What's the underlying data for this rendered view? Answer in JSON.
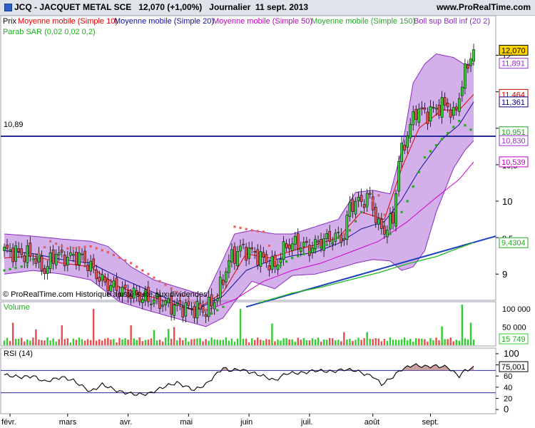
{
  "header": {
    "title": "JCQ - JACQUET METAL SCE   12,070 (+1,00%)   Journalier  11 sept. 2013",
    "site": "www.ProRealTime.com"
  },
  "legend": {
    "prix": "Prix",
    "ma10": "Moyenne mobile (Simple 10)",
    "ma20": "Moyenne mobile (Simple 20)",
    "ma50": "Moyenne mobile (Simple 50)",
    "ma150": "Moyenne mobile (Simple 150)",
    "boll": "Boll sup Boll inf (20 2)",
    "sar": "Parab SAR (0,02 0,02 0,2)"
  },
  "copyright": "© ProRealTime.com  Historique ajusté suite aux dividendes",
  "hline_label": "10,89",
  "price_tags": [
    {
      "text": "12,070",
      "value": 12.07,
      "bg": "#ffd400",
      "fg": "#000000",
      "border": "#000000"
    },
    {
      "text": "11,891",
      "value": 11.891,
      "bg": "#ffffff",
      "fg": "#9b30c8",
      "border": "#9b30c8"
    },
    {
      "text": "11,464",
      "value": 11.464,
      "bg": "#ffffff",
      "fg": "#d00000",
      "border": "#d00000"
    },
    {
      "text": "11,361",
      "value": 11.361,
      "bg": "#ffffff",
      "fg": "#000080",
      "border": "#000080"
    },
    {
      "text": "10,951",
      "value": 10.951,
      "bg": "#ffffff",
      "fg": "#20a020",
      "border": "#20a020"
    },
    {
      "text": "10,830",
      "value": 10.83,
      "bg": "#ffffff",
      "fg": "#9b30c8",
      "border": "#9b30c8"
    },
    {
      "text": "10,539",
      "value": 10.539,
      "bg": "#ffffff",
      "fg": "#c000c0",
      "border": "#c000c0"
    },
    {
      "text": "9,4304",
      "value": 9.4304,
      "bg": "#ffffff",
      "fg": "#22aa22",
      "border": "#22aa22"
    }
  ],
  "volume_tag": "15 749",
  "rsi_tag": "75,001",
  "volume_label": "Volume",
  "rsi_label": "RSI (14)",
  "colors": {
    "up": "#33cc33",
    "down": "#e05050",
    "boll_fill": "#b070d8",
    "boll_line": "#8a2bbf",
    "ma10": "#e00000",
    "ma20": "#1010a0",
    "ma50": "#d000d0",
    "ma150": "#22bb22",
    "sar": "#22aa22",
    "sar_down": "#e06060",
    "hline": "#2a2a9a",
    "trend": "#2040c0"
  },
  "chart_data": [
    {
      "type": "candlestick",
      "name": "Prix",
      "x_labels": [
        "févr.",
        "mars",
        "avr.",
        "mai",
        "juin",
        "juil.",
        "août",
        "sept."
      ],
      "y_ticks": [
        "9",
        "9,5",
        "10",
        "10,5",
        "11",
        "11,5",
        "12"
      ],
      "ylim": [
        8.65,
        12.25
      ],
      "horizontal_line": 10.89,
      "legend_placement": "top-left",
      "grid": false,
      "close_anchors": [
        [
          0,
          9.32
        ],
        [
          6,
          9.28
        ],
        [
          10,
          9.25
        ],
        [
          14,
          9.05
        ],
        [
          18,
          9.3
        ],
        [
          20,
          9.22
        ],
        [
          26,
          9.25
        ],
        [
          30,
          9.1
        ],
        [
          34,
          8.9
        ],
        [
          40,
          8.78
        ],
        [
          46,
          8.7
        ],
        [
          50,
          8.66
        ],
        [
          60,
          8.55
        ],
        [
          70,
          8.5
        ],
        [
          74,
          8.7
        ],
        [
          78,
          9.18
        ],
        [
          82,
          9.35
        ],
        [
          86,
          9.3
        ],
        [
          90,
          9.2
        ],
        [
          94,
          9.1
        ],
        [
          98,
          9.4
        ],
        [
          102,
          9.42
        ],
        [
          106,
          9.35
        ],
        [
          110,
          9.45
        ],
        [
          114,
          9.5
        ],
        [
          118,
          9.52
        ],
        [
          120,
          9.95
        ],
        [
          124,
          10.0
        ],
        [
          127,
          10.05
        ],
        [
          130,
          9.65
        ],
        [
          132,
          9.6
        ],
        [
          135,
          9.75
        ],
        [
          137,
          10.55
        ],
        [
          139,
          10.8
        ],
        [
          143,
          11.25
        ],
        [
          147,
          11.2
        ],
        [
          151,
          11.3
        ],
        [
          154,
          11.32
        ],
        [
          156,
          11.15
        ],
        [
          158,
          11.45
        ],
        [
          161,
          11.9
        ],
        [
          163,
          12.07
        ]
      ],
      "ma10_anchors": [
        [
          0,
          9.22
        ],
        [
          10,
          9.25
        ],
        [
          20,
          9.15
        ],
        [
          30,
          9.1
        ],
        [
          40,
          8.82
        ],
        [
          50,
          8.7
        ],
        [
          66,
          8.5
        ],
        [
          76,
          8.75
        ],
        [
          84,
          9.28
        ],
        [
          92,
          9.22
        ],
        [
          100,
          9.32
        ],
        [
          108,
          9.4
        ],
        [
          116,
          9.5
        ],
        [
          124,
          9.85
        ],
        [
          132,
          9.75
        ],
        [
          138,
          10.45
        ],
        [
          144,
          11.0
        ],
        [
          152,
          11.25
        ],
        [
          158,
          11.25
        ],
        [
          163,
          11.464
        ]
      ],
      "ma20_anchors": [
        [
          0,
          9.32
        ],
        [
          10,
          9.28
        ],
        [
          20,
          9.2
        ],
        [
          30,
          9.15
        ],
        [
          40,
          8.95
        ],
        [
          50,
          8.78
        ],
        [
          66,
          8.5
        ],
        [
          76,
          8.7
        ],
        [
          84,
          9.05
        ],
        [
          92,
          9.18
        ],
        [
          100,
          9.25
        ],
        [
          108,
          9.3
        ],
        [
          116,
          9.42
        ],
        [
          124,
          9.62
        ],
        [
          132,
          9.72
        ],
        [
          138,
          10.02
        ],
        [
          144,
          10.42
        ],
        [
          152,
          10.85
        ],
        [
          158,
          11.05
        ],
        [
          163,
          11.361
        ]
      ],
      "ma50_anchors": [
        [
          70,
          8.5
        ],
        [
          80,
          8.65
        ],
        [
          90,
          8.9
        ],
        [
          100,
          9.05
        ],
        [
          110,
          9.15
        ],
        [
          120,
          9.3
        ],
        [
          130,
          9.45
        ],
        [
          140,
          9.72
        ],
        [
          150,
          10.05
        ],
        [
          158,
          10.3
        ],
        [
          163,
          10.539
        ]
      ],
      "ma150_anchors": [
        [
          88,
          8.6
        ],
        [
          100,
          8.74
        ],
        [
          110,
          8.82
        ],
        [
          120,
          8.92
        ],
        [
          130,
          9.02
        ],
        [
          140,
          9.14
        ],
        [
          150,
          9.24
        ],
        [
          158,
          9.36
        ],
        [
          163,
          9.4304
        ]
      ],
      "boll_upper_anchors": [
        [
          0,
          9.55
        ],
        [
          10,
          9.52
        ],
        [
          20,
          9.48
        ],
        [
          30,
          9.45
        ],
        [
          36,
          9.38
        ],
        [
          44,
          9.1
        ],
        [
          52,
          8.92
        ],
        [
          70,
          8.7
        ],
        [
          76,
          9.2
        ],
        [
          80,
          9.55
        ],
        [
          86,
          9.6
        ],
        [
          94,
          9.55
        ],
        [
          100,
          9.55
        ],
        [
          108,
          9.65
        ],
        [
          116,
          9.75
        ],
        [
          122,
          10.12
        ],
        [
          128,
          10.15
        ],
        [
          134,
          10.1
        ],
        [
          138,
          10.7
        ],
        [
          142,
          11.62
        ],
        [
          146,
          11.88
        ],
        [
          150,
          12.02
        ],
        [
          156,
          11.97
        ],
        [
          160,
          11.87
        ],
        [
          163,
          11.891
        ]
      ],
      "boll_lower_anchors": [
        [
          0,
          9.0
        ],
        [
          10,
          9.05
        ],
        [
          20,
          9.0
        ],
        [
          30,
          8.92
        ],
        [
          40,
          8.62
        ],
        [
          50,
          8.5
        ],
        [
          70,
          8.28
        ],
        [
          76,
          8.4
        ],
        [
          80,
          8.62
        ],
        [
          86,
          8.9
        ],
        [
          94,
          8.8
        ],
        [
          100,
          8.98
        ],
        [
          108,
          9.0
        ],
        [
          116,
          9.08
        ],
        [
          122,
          9.15
        ],
        [
          128,
          9.2
        ],
        [
          134,
          9.18
        ],
        [
          138,
          9.05
        ],
        [
          142,
          9.1
        ],
        [
          146,
          9.32
        ],
        [
          150,
          9.85
        ],
        [
          156,
          10.45
        ],
        [
          160,
          10.7
        ],
        [
          163,
          10.83
        ]
      ],
      "sar_anchors": [
        [
          0,
          9.05
        ],
        [
          8,
          9.12
        ],
        [
          16,
          9.45
        ],
        [
          22,
          9.35
        ],
        [
          30,
          9.38
        ],
        [
          36,
          9.3
        ],
        [
          44,
          9.15
        ],
        [
          50,
          9.0
        ],
        [
          72,
          8.46
        ],
        [
          76,
          8.55
        ],
        [
          80,
          9.65
        ],
        [
          86,
          9.6
        ],
        [
          90,
          9.58
        ],
        [
          95,
          9.1
        ],
        [
          100,
          9.22
        ],
        [
          106,
          9.3
        ],
        [
          112,
          9.4
        ],
        [
          120,
          9.6
        ],
        [
          124,
          9.85
        ],
        [
          130,
          10.08
        ],
        [
          134,
          9.55
        ],
        [
          140,
          10.0
        ],
        [
          146,
          10.6
        ],
        [
          152,
          10.85
        ],
        [
          158,
          11.1
        ],
        [
          163,
          10.951
        ]
      ]
    },
    {
      "type": "bar",
      "name": "Volume",
      "y_ticks": [
        "50 000",
        "100 000"
      ],
      "ylim": [
        0,
        110000
      ],
      "last_value": 15749,
      "spikes": [
        [
          3,
          62000
        ],
        [
          11,
          44000
        ],
        [
          20,
          55000
        ],
        [
          31,
          100000
        ],
        [
          44,
          55000
        ],
        [
          52,
          42000
        ],
        [
          57,
          45000
        ],
        [
          59,
          50000
        ],
        [
          82,
          100000
        ],
        [
          93,
          60000
        ],
        [
          118,
          36000
        ],
        [
          126,
          36000
        ],
        [
          152,
          52000
        ],
        [
          159,
          112000
        ],
        [
          162,
          62000
        ]
      ]
    },
    {
      "type": "line",
      "name": "RSI (14)",
      "y_ticks": [
        "0",
        "20",
        "40",
        "60",
        "80",
        "100"
      ],
      "ylim": [
        -5,
        105
      ],
      "levels": [
        30,
        70
      ],
      "last_value": 75.001,
      "anchors": [
        [
          0,
          62
        ],
        [
          6,
          58
        ],
        [
          10,
          60
        ],
        [
          14,
          50
        ],
        [
          20,
          58
        ],
        [
          24,
          52
        ],
        [
          30,
          32
        ],
        [
          34,
          45
        ],
        [
          40,
          32
        ],
        [
          46,
          27
        ],
        [
          50,
          28
        ],
        [
          56,
          42
        ],
        [
          60,
          48
        ],
        [
          66,
          35
        ],
        [
          70,
          45
        ],
        [
          76,
          75
        ],
        [
          78,
          70
        ],
        [
          82,
          72
        ],
        [
          86,
          66
        ],
        [
          90,
          60
        ],
        [
          94,
          52
        ],
        [
          98,
          65
        ],
        [
          104,
          66
        ],
        [
          108,
          70
        ],
        [
          114,
          68
        ],
        [
          118,
          72
        ],
        [
          122,
          70
        ],
        [
          126,
          62
        ],
        [
          128,
          60
        ],
        [
          131,
          45
        ],
        [
          134,
          55
        ],
        [
          138,
          72
        ],
        [
          142,
          80
        ],
        [
          146,
          77
        ],
        [
          150,
          78
        ],
        [
          154,
          76
        ],
        [
          156,
          67
        ],
        [
          158,
          60
        ],
        [
          160,
          70
        ],
        [
          163,
          75.0
        ]
      ]
    }
  ]
}
